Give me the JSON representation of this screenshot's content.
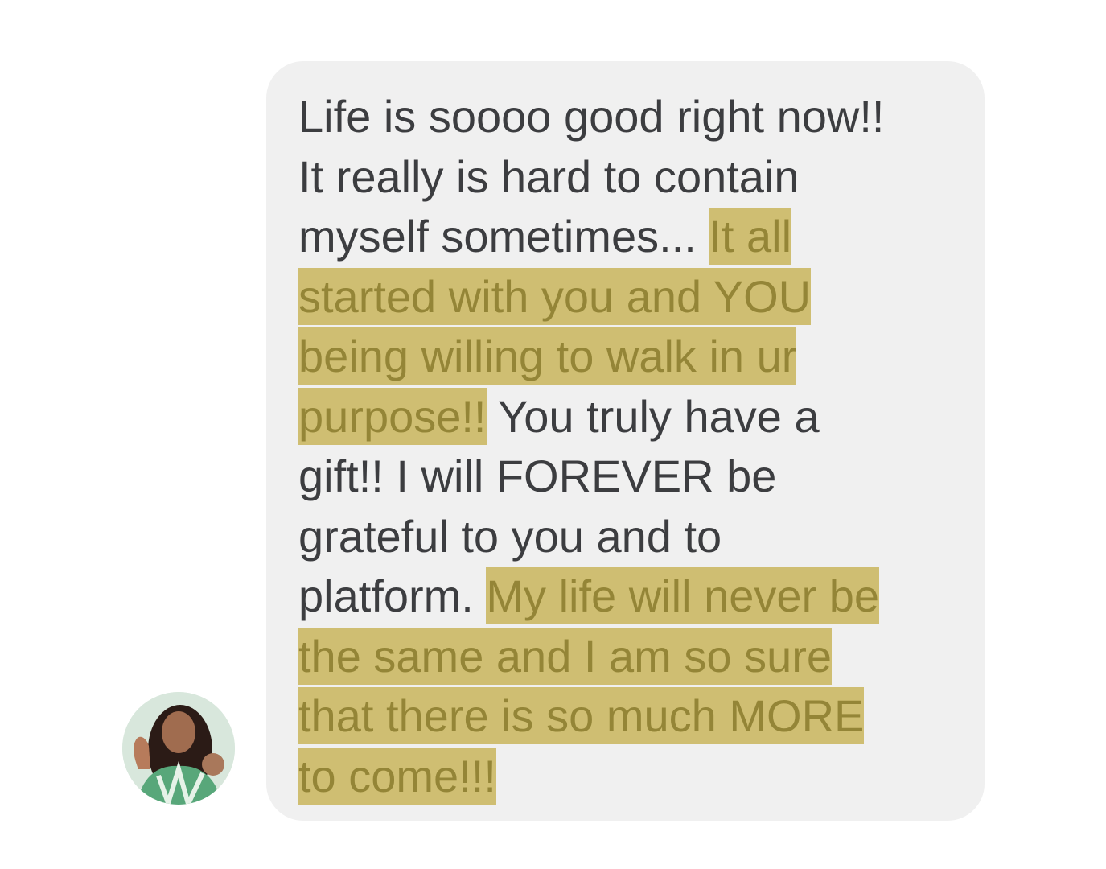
{
  "conversation": {
    "avatar_icon": "profile-photo-icon",
    "message": {
      "segments": [
        {
          "text": "Life is soooo good right now!!\nIt really is hard to contain\nmyself sometimes... ",
          "highlighted": false
        },
        {
          "text": "It all\nstarted with you and YOU\nbeing willing to walk in ur\npurpose!!",
          "highlighted": true
        },
        {
          "text": " You truly have a\ngift!!  I will FOREVER be\ngrateful to you and to\nplatform. ",
          "highlighted": false
        },
        {
          "text": "My life will never be\nthe same and I am so sure\nthat there is so much MORE\nto come!!!",
          "highlighted": true
        }
      ]
    }
  },
  "colors": {
    "bubble_background": "#f0f0f0",
    "text": "#3c3d40",
    "highlight_background": "#cfbe72",
    "highlight_text": "#948537"
  }
}
